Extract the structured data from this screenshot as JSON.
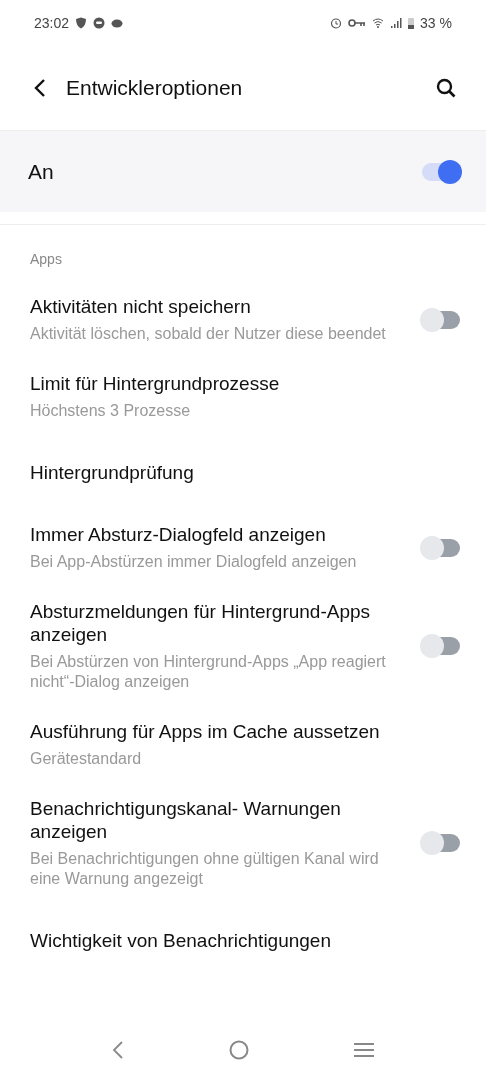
{
  "status_bar": {
    "time": "23:02",
    "battery": "33 %"
  },
  "header": {
    "title": "Entwickleroptionen"
  },
  "master": {
    "label": "An",
    "on": true
  },
  "section": {
    "title": "Apps"
  },
  "items": [
    {
      "kind": "toggle",
      "title": "Aktivitäten nicht speichern",
      "subtitle": "Aktivität löschen, sobald der Nutzer diese beendet",
      "on": false
    },
    {
      "kind": "value",
      "title": "Limit für Hintergrundprozesse",
      "subtitle": "Höchstens 3 Prozesse"
    },
    {
      "kind": "link",
      "title": "Hintergrundprüfung"
    },
    {
      "kind": "toggle",
      "title": "Immer Absturz-Dialogfeld anzeigen",
      "subtitle": "Bei App-Abstürzen immer Dialogfeld anzeigen",
      "on": false
    },
    {
      "kind": "toggle",
      "title": "Absturzmeldungen für Hintergrund-Apps anzeigen",
      "subtitle": "Bei Abstürzen von Hintergrund-Apps „App reagiert nicht“-Dialog anzeigen",
      "on": false
    },
    {
      "kind": "value",
      "title": "Ausführung für Apps im Cache aussetzen",
      "subtitle": "Gerätestandard"
    },
    {
      "kind": "toggle",
      "title": "Benachrichtigungskanal- Warnungen anzeigen",
      "subtitle": "Bei Benachrichtigungen ohne gültigen Kanal wird eine Warnung angezeigt",
      "on": false
    },
    {
      "kind": "link",
      "title": "Wichtigkeit von Benachrichtigungen"
    }
  ]
}
